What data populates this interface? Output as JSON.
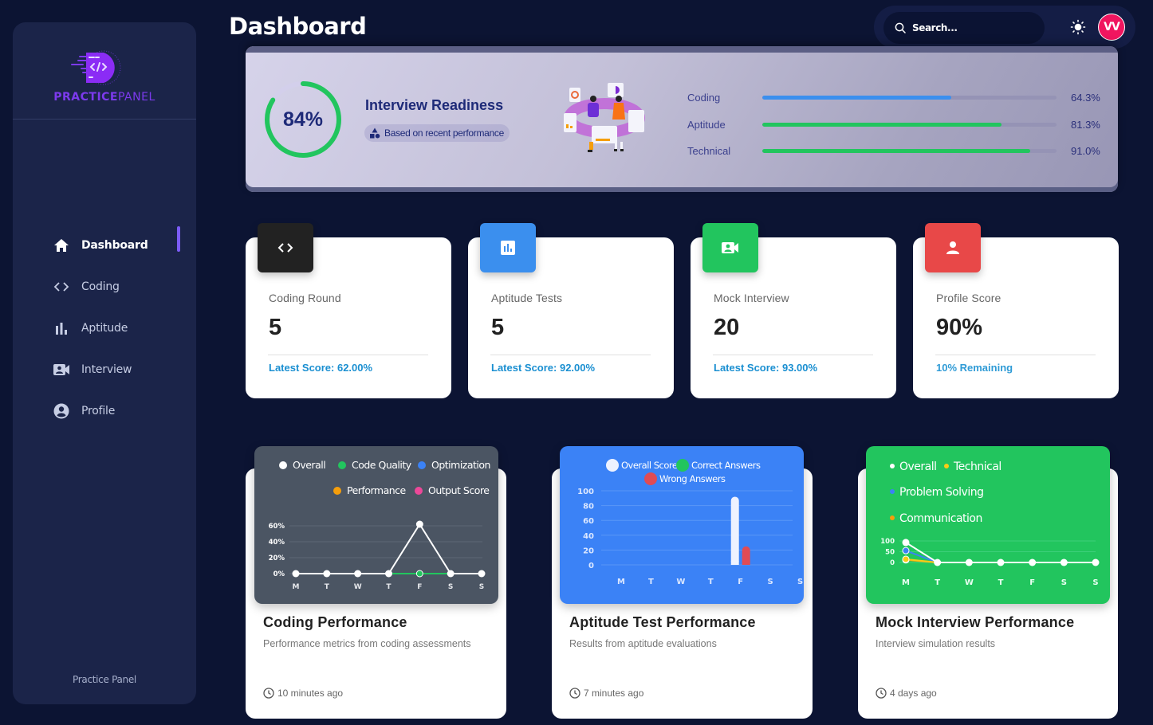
{
  "app": {
    "brand_bold": "PRACTICE",
    "brand_light": "PANEL",
    "footer": "Practice Panel"
  },
  "sidebar": {
    "items": [
      {
        "label": "Dashboard",
        "icon": "home-icon",
        "active": true
      },
      {
        "label": "Coding",
        "icon": "code-icon",
        "active": false
      },
      {
        "label": "Aptitude",
        "icon": "bar-chart-icon",
        "active": false
      },
      {
        "label": "Interview",
        "icon": "video-contact-icon",
        "active": false
      },
      {
        "label": "Profile",
        "icon": "account-circle-icon",
        "active": false
      }
    ]
  },
  "header": {
    "title": "Dashboard",
    "search_placeholder": "Search...",
    "theme_icon": "sun-icon",
    "avatar_initials": "VV"
  },
  "colors": {
    "accent": "#7c3aed",
    "avatar": "#f0155f",
    "green": "#22c55e",
    "blue": "#3b8fee",
    "red": "#ef4444",
    "dark": "#222222",
    "link": "#1a8fd1"
  },
  "readiness": {
    "percent": 84,
    "percent_label": "84%",
    "title": "Interview Readiness",
    "chip": "Based on recent performance",
    "skills": [
      {
        "name": "Coding",
        "value": 64.3,
        "label": "64.3%",
        "color": "#3b8fee"
      },
      {
        "name": "Aptitude",
        "value": 81.3,
        "label": "81.3%",
        "color": "#22c55e"
      },
      {
        "name": "Technical",
        "value": 91.0,
        "label": "91.0%",
        "color": "#22c55e"
      }
    ]
  },
  "stats": [
    {
      "label": "Coding Round",
      "value": "5",
      "footer": "Latest Score: 62.00%",
      "icon": "code-icon",
      "color": "#222222"
    },
    {
      "label": "Aptitude Tests",
      "value": "5",
      "footer": "Latest Score: 92.00%",
      "icon": "bar-chart-icon",
      "color": "#3b8fee"
    },
    {
      "label": "Mock Interview",
      "value": "20",
      "footer": "Latest Score: 93.00%",
      "icon": "video-contact-icon",
      "color": "#22c55e"
    },
    {
      "label": "Profile Score",
      "value": "90%",
      "footer": "10% Remaining",
      "icon": "person-icon",
      "color": "#ef4444"
    }
  ],
  "cards": [
    {
      "title": "Coding Performance",
      "subtitle": "Performance metrics from coding assessments",
      "time": "10 minutes ago"
    },
    {
      "title": "Aptitude Test Performance",
      "subtitle": "Results from aptitude evaluations",
      "time": "7 minutes ago"
    },
    {
      "title": "Mock Interview Performance",
      "subtitle": "Interview simulation results",
      "time": "4 days ago"
    }
  ],
  "chart_data": [
    {
      "type": "line",
      "title": "Coding Performance",
      "categories": [
        "M",
        "T",
        "W",
        "T",
        "F",
        "S",
        "S"
      ],
      "ylim": [
        0,
        60
      ],
      "yticks": [
        "0%",
        "20%",
        "40%",
        "60%"
      ],
      "ytick_values": [
        0,
        20,
        40,
        60
      ],
      "legend": "top",
      "grid": true,
      "series": [
        {
          "name": "Overall",
          "color": "#ffffff",
          "values": [
            0,
            0,
            0,
            0,
            62,
            0,
            0
          ]
        },
        {
          "name": "Code Quality",
          "color": "#22c55e",
          "values": [
            0,
            0,
            0,
            0,
            0,
            0,
            0
          ]
        },
        {
          "name": "Optimization",
          "color": "#3b82f6",
          "values": [
            0,
            0,
            0,
            0,
            0,
            0,
            0
          ]
        },
        {
          "name": "Performance",
          "color": "#f59e0b",
          "values": [
            0,
            0,
            0,
            0,
            0,
            0,
            0
          ]
        },
        {
          "name": "Output Score",
          "color": "#ec4899",
          "values": [
            0,
            0,
            0,
            0,
            0,
            0,
            0
          ]
        }
      ]
    },
    {
      "type": "bar",
      "title": "Aptitude Test Performance",
      "categories": [
        "M",
        "T",
        "W",
        "T",
        "F",
        "S",
        "S"
      ],
      "ylim": [
        0,
        100
      ],
      "yticks": [
        "0",
        "20",
        "40",
        "60",
        "80",
        "100"
      ],
      "ytick_values": [
        0,
        20,
        40,
        60,
        80,
        100
      ],
      "legend": "top",
      "grid": true,
      "series": [
        {
          "name": "Overall Score",
          "color": "#eef2ff",
          "values": [
            0,
            0,
            0,
            0,
            92,
            0,
            0
          ]
        },
        {
          "name": "Correct Answers",
          "color": "#22c55e",
          "values": [
            0,
            0,
            0,
            0,
            0,
            0,
            0
          ]
        },
        {
          "name": "Wrong Answers",
          "color": "#e04b55",
          "values": [
            0,
            0,
            0,
            0,
            25,
            0,
            0
          ]
        }
      ]
    },
    {
      "type": "line",
      "title": "Mock Interview Performance",
      "categories": [
        "M",
        "T",
        "W",
        "T",
        "F",
        "S",
        "S"
      ],
      "ylim": [
        0,
        100
      ],
      "yticks": [
        "0",
        "50",
        "100"
      ],
      "ytick_values": [
        0,
        50,
        100
      ],
      "legend": "top-left",
      "grid": true,
      "series": [
        {
          "name": "Overall",
          "color": "#ffffff",
          "values": [
            93,
            0,
            0,
            0,
            0,
            0,
            0
          ]
        },
        {
          "name": "Technical",
          "color": "#facc15",
          "values": [
            15,
            0,
            0,
            0,
            0,
            0,
            0
          ]
        },
        {
          "name": "Problem Solving",
          "color": "#3b82f6",
          "values": [
            55,
            0,
            0,
            0,
            0,
            0,
            0
          ]
        },
        {
          "name": "Communication",
          "color": "#f59e0b",
          "values": [
            12,
            0,
            0,
            0,
            0,
            0,
            0
          ]
        }
      ]
    }
  ]
}
